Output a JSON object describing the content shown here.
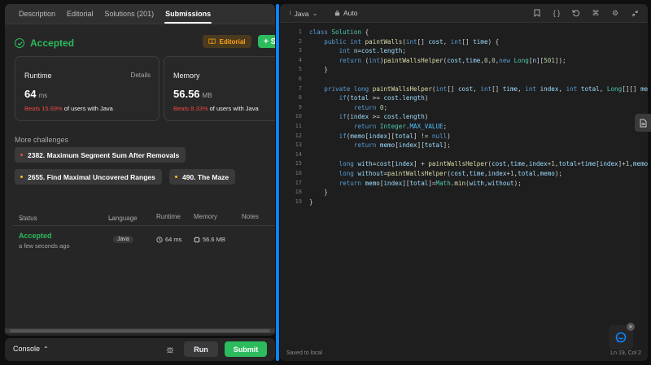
{
  "tabs": [
    "Description",
    "Editorial",
    "Solutions (201)",
    "Submissions"
  ],
  "active_tab": "Submissions",
  "result": {
    "title": "Accepted",
    "editorial_label": "Editorial",
    "plus_label": "+ S"
  },
  "runtime": {
    "label": "Runtime",
    "details": "Details",
    "value": "64",
    "unit": "ms",
    "beats_pct": "Beats 15.69%",
    "beats_suffix": "of users with Java"
  },
  "memory": {
    "label": "Memory",
    "value": "56.56",
    "unit": "MB",
    "beats_pct": "Beats 8.33%",
    "beats_suffix": "of users with Java"
  },
  "more": {
    "title": "More challenges",
    "items": [
      {
        "label": "2382. Maximum Segment Sum After Removals",
        "difficulty": "hard"
      },
      {
        "label": "2655. Find Maximal Uncovered Ranges",
        "difficulty": "medium"
      },
      {
        "label": "490. The Maze",
        "difficulty": "medium"
      }
    ]
  },
  "submissions": {
    "headers": {
      "status": "Status",
      "language": "Language",
      "runtime": "Runtime",
      "memory": "Memory",
      "notes": "Notes"
    },
    "rows": [
      {
        "status": "Accepted",
        "time": "a few seconds ago",
        "language": "Java",
        "runtime": "64 ms",
        "memory": "56.6 MB"
      }
    ]
  },
  "console": {
    "label": "Console",
    "run": "Run",
    "submit": "Submit"
  },
  "editor": {
    "language": "Java",
    "mode": "Auto",
    "saved": "Saved to local",
    "cursor": "Ln 19, Col 2"
  },
  "code_lines": [
    "class Solution {",
    "    public int paintWalls(int[] cost, int[] time) {",
    "        int n=cost.length;",
    "        return (int)paintWallsHelper(cost,time,0,0,new Long[n][501]);",
    "    }",
    "",
    "    private long paintWallsHelper(int[] cost, int[] time, int index, int total, Long[][] memo) {",
    "        if(total >= cost.length)",
    "            return 0;",
    "        if(index >= cost.length)",
    "            return Integer.MAX_VALUE;",
    "        if(memo[index][total] != null)",
    "            return memo[index][total];",
    "",
    "        long with=cost[index] + paintWallsHelper(cost,time,index+1,total+time[index]+1,memo);",
    "        long without=paintWallsHelper(cost,time,index+1,total,memo);",
    "        return memo[index][total]=Math.min(with,without);",
    "    }",
    "}"
  ],
  "colors": {
    "accent_green": "#2cbb5d",
    "accent_orange": "#ffa116",
    "accent_blue": "#0a84ff",
    "beats_red": "#ef4743"
  }
}
